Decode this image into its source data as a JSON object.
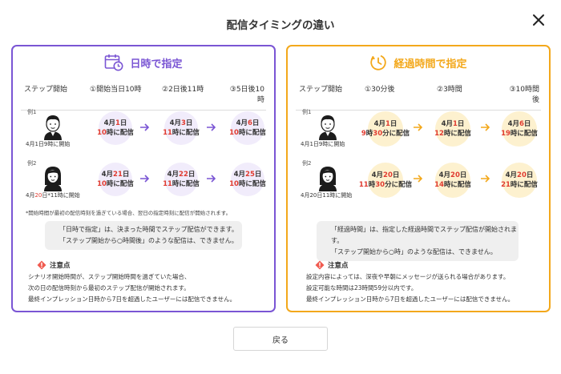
{
  "modal": {
    "title": "配信タイミングの違い",
    "back_label": "戻る"
  },
  "left": {
    "title": "日時で指定",
    "steps": [
      "ステップ開始",
      "①開始当日10時",
      "②2日後11時",
      "③5日後10時"
    ],
    "examples": [
      {
        "label": "例1",
        "start_a": "4月1日9時に開始",
        "start_hl": "",
        "start_b": "",
        "bubbles": [
          {
            "l1a": "4月",
            "l1r": "1",
            "l1b": "日",
            "l2r": "10",
            "l2b": "時に配信"
          },
          {
            "l1a": "4月",
            "l1r": "3",
            "l1b": "日",
            "l2r": "11",
            "l2b": "時に配信"
          },
          {
            "l1a": "4月",
            "l1r": "6",
            "l1b": "日",
            "l2r": "10",
            "l2b": "時に配信"
          }
        ]
      },
      {
        "label": "例2",
        "start_a": "4月",
        "start_hl": "20",
        "start_b": "日*11時に開始",
        "bubbles": [
          {
            "l1a": "4月",
            "l1r": "21",
            "l1b": "日",
            "l2r": "10",
            "l2b": "時に配信"
          },
          {
            "l1a": "4月",
            "l1r": "22",
            "l1b": "日",
            "l2r": "11",
            "l2b": "時に配信"
          },
          {
            "l1a": "4月",
            "l1r": "25",
            "l1b": "日",
            "l2r": "10",
            "l2b": "時に配信"
          }
        ]
      }
    ],
    "footnote": "*開始時間が最初の配信時刻を過ぎている場合、翌日の指定時刻に配信が開始されます。",
    "info": [
      "「日時で指定」は、決まった時間でステップ配信ができます。",
      "「ステップ開始から○時間後」のような配信は、できません。"
    ],
    "caution_title": "注意点",
    "caution": [
      "シナリオ開始時間が、ステップ開始時間を過ぎていた場合、",
      "次の日の配信時刻から最初のステップ配信が開始されます。",
      "最終インプレッション日時から7日を超過したユーザーには配信できません。"
    ]
  },
  "right": {
    "title": "経過時間で指定",
    "steps": [
      "ステップ開始",
      "①30分後",
      "②3時間",
      "③10時間後"
    ],
    "examples": [
      {
        "label": "例1",
        "start_a": "4月1日9時に開始",
        "start_hl": "",
        "start_b": "",
        "bubbles": [
          {
            "l1a": "4月",
            "l1r": "1",
            "l1b": "日",
            "l2r": "9",
            "l2m": "時",
            "l2r2": "30",
            "l2b": "分に配信"
          },
          {
            "l1a": "4月",
            "l1r": "1",
            "l1b": "日",
            "l2r": "12",
            "l2m": "",
            "l2r2": "",
            "l2b": "時に配信"
          },
          {
            "l1a": "4月",
            "l1r": "6",
            "l1b": "日",
            "l2r": "19",
            "l2m": "",
            "l2r2": "",
            "l2b": "時に配信"
          }
        ]
      },
      {
        "label": "例2",
        "start_a": "4月20日11時に開始",
        "start_hl": "",
        "start_b": "",
        "bubbles": [
          {
            "l1a": "4月",
            "l1r": "20",
            "l1b": "日",
            "l2r": "11",
            "l2m": "時",
            "l2r2": "30",
            "l2b": "分に配信"
          },
          {
            "l1a": "4月",
            "l1r": "20",
            "l1b": "日",
            "l2r": "14",
            "l2m": "",
            "l2r2": "",
            "l2b": "時に配信"
          },
          {
            "l1a": "4月",
            "l1r": "20",
            "l1b": "日",
            "l2r": "21",
            "l2m": "",
            "l2r2": "",
            "l2b": "時に配信"
          }
        ]
      }
    ],
    "info": [
      "「経過時間」は、指定した経過時間でステップ配信が開始されます。",
      "「ステップ開始から○時」のような配信は、できません。"
    ],
    "caution_title": "注意点",
    "caution": [
      "設定内容によっては、深夜や早朝にメッセージが送られる場合があります。",
      "設定可能な時間は23時間59分以内です。",
      "最終インプレッション日時から7日を超過したユーザーには配信できません。"
    ]
  },
  "colors": {
    "left_accent": "#7a55d4",
    "right_accent": "#f3a81b",
    "highlight_red": "#e03c31"
  }
}
